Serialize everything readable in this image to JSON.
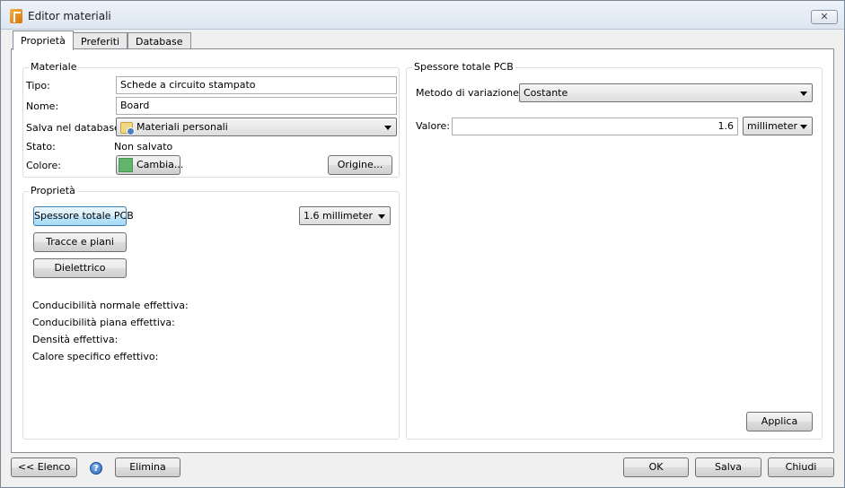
{
  "window": {
    "title": "Editor materiali",
    "close_label": "✕"
  },
  "tabs": [
    {
      "label": "Proprietà",
      "active": true
    },
    {
      "label": "Preferiti",
      "active": false
    },
    {
      "label": "Database",
      "active": false
    }
  ],
  "materiale": {
    "title": "Materiale",
    "tipo_label": "Tipo:",
    "tipo_value": "Schede a circuito stampato",
    "nome_label": "Nome:",
    "nome_value": "Board",
    "salva_label": "Salva nel database:",
    "salva_value": "Materiali personali",
    "stato_label": "Stato:",
    "stato_value": "Non salvato",
    "colore_label": "Colore:",
    "cambia_label": "Cambia...",
    "origine_label": "Origine...",
    "color": "#62b36b"
  },
  "proprieta": {
    "title": "Proprietà",
    "buttons": {
      "spessore": "Spessore totale PCB",
      "tracce": "Tracce e piani",
      "dielettrico": "Dielettrico"
    },
    "spessore_value": "1.6 millimeter",
    "effective": [
      "Conducibilità normale effettiva:",
      "Conducibilità piana effettiva:",
      "Densità effettiva:",
      "Calore specifico effettivo:"
    ]
  },
  "spessore_panel": {
    "title": "Spessore totale PCB",
    "metodo_label": "Metodo di variazione:",
    "metodo_value": "Costante",
    "valore_label": "Valore:",
    "valore_value": "1.6",
    "unit_value": "millimeter",
    "applica_label": "Applica"
  },
  "footer": {
    "elenco_label": "<< Elenco",
    "help_label": "?",
    "elimina_label": "Elimina",
    "ok_label": "OK",
    "salva_label": "Salva",
    "chiudi_label": "Chiudi"
  },
  "colors": {
    "selected_button": "#bee6fd",
    "color_swatch": "#62b36b"
  }
}
